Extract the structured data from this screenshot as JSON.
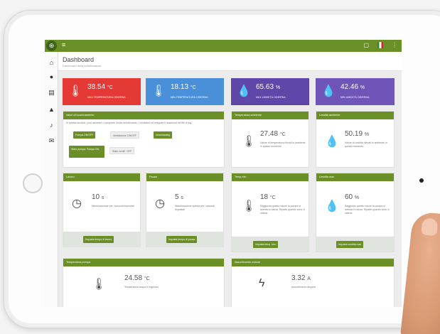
{
  "topbar": {
    "menu_icon": "hamburger-icon",
    "notification_icon": "bell-icon",
    "more_icon": "kebab-icon"
  },
  "sidebar": {
    "icons": [
      "home-icon",
      "info-icon",
      "calendar-icon",
      "warning-icon",
      "bell-icon",
      "mail-icon"
    ]
  },
  "header": {
    "title": "Dashboard",
    "subtitle": "Dashboard della nebulizzatore"
  },
  "kpis": [
    {
      "value": "38.54",
      "unit": "°C",
      "label": "MAX TEMPERATURA ODIERNA",
      "color": "#e53935",
      "icon": "thermometer-icon"
    },
    {
      "value": "18.13",
      "unit": "°C",
      "label": "MIN TEMPERATURA ODIERNA",
      "color": "#4a90d9",
      "icon": "thermometer-icon"
    },
    {
      "value": "65.63",
      "unit": "%",
      "label": "MAX UMIDITÀ ODIERNA",
      "color": "#5e47a8",
      "icon": "humidity-icon"
    },
    {
      "value": "42.46",
      "unit": "%",
      "label": "MIN UMIDITÀ ODIERNA",
      "color": "#6f55b8",
      "icon": "humidity-icon"
    }
  ],
  "valves": {
    "title": "Valori di funzionamento",
    "text": "In questa sezione, puoi azionare o spegnere l'unità nebulizzante, i ventilatori ed eseguire il download del file di log.",
    "buttons": {
      "pump": "Pompa ON/OFF",
      "fan": "Ventilazione ON/OFF",
      "download": "Downloading"
    },
    "state_button": "Stato pompa: Pompa ON",
    "status_chip": "Stato ventil.: OFF"
  },
  "temp_card": {
    "title": "Temperatura ambiente",
    "value": "27.48",
    "unit": "°C",
    "desc": "Valore di temperatura rilevati in ambiente in questo momento."
  },
  "hum_card": {
    "title": "Umidità ambiente",
    "value": "50.19",
    "unit": "%",
    "desc": "Valore di umidità rilevati in ambiente in questo momento."
  },
  "work": {
    "title": "Lavoro",
    "value": "10",
    "unit": "s",
    "desc": "Nebulizzazione per i secondi impostati",
    "button": "Imposta tempo di lavoro"
  },
  "pause": {
    "title": "Pausa",
    "value": "5",
    "unit": "s",
    "desc": "Nebulizzazione spenta per i secondi impostati",
    "button": "Imposta tempo di pausa"
  },
  "tmin": {
    "title": "Temp min",
    "value": "18",
    "unit": "°C",
    "desc": "Raggiunto questo valore la pompa si arresta in causa. Riparte quando sono ci ottiene.",
    "button": "Imposta temp. min"
  },
  "hmax": {
    "title": "Umidità max",
    "value": "60",
    "unit": "%",
    "desc": "Raggiunto questo valore la pompa si arresta in causa. Riparte quando sono ci ottiene.",
    "button": "Imposta umidità max"
  },
  "pump_temp": {
    "title": "Temperatura pompa",
    "value": "24.58",
    "unit": "°C",
    "desc": "Temperatura acqua in ingresso"
  },
  "motor": {
    "title": "Assorbimento motore",
    "value": "3.32",
    "unit": "A",
    "desc": "Assorbimento ampere"
  }
}
